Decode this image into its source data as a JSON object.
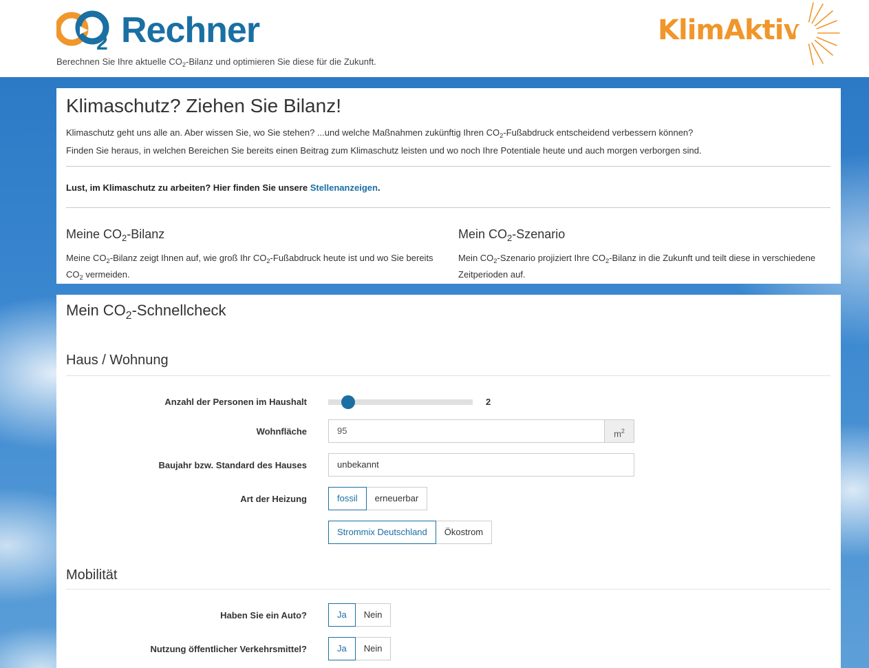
{
  "header": {
    "logo_text": "Rechner",
    "tagline_before": "Berechnen Sie Ihre aktuelle CO",
    "tagline_sub": "2",
    "tagline_after": "-Bilanz und optimieren Sie diese für die Zukunft.",
    "partner_logo_text": "KlimAktiv"
  },
  "colors": {
    "brand_blue": "#1a6fa3",
    "brand_orange": "#f0962a",
    "sky_blue": "#2c79c6"
  },
  "intro": {
    "title": "Klimaschutz? Ziehen Sie Bilanz!",
    "line1_before": "Klimaschutz geht uns alle an. Aber wissen Sie, wo Sie stehen? ...und welche Maßnahmen zukünftig Ihren CO",
    "line1_sub": "2",
    "line1_after": "-Fußabdruck entscheidend verbessern können?",
    "line2": "Finden Sie heraus, in welchen Bereichen Sie bereits einen Beitrag zum Klimaschutz leisten und wo noch Ihre Potentiale heute und auch morgen verborgen sind.",
    "jobs_text": "Lust, im Klimaschutz zu arbeiten? Hier finden Sie unsere ",
    "jobs_link": "Stellenanzeigen",
    "jobs_end": "."
  },
  "bilanz": {
    "title_before": "Meine CO",
    "title_after": "-Bilanz",
    "text_a": "Meine CO",
    "text_b": "-Bilanz zeigt Ihnen auf, wie groß Ihr CO",
    "text_c": "-Fußabdruck heute ist und wo Sie bereits CO",
    "text_d": " vermeiden."
  },
  "szenario": {
    "title_before": "Mein CO",
    "title_after": "-Szenario",
    "text_a": "Mein CO",
    "text_b": "-Szenario projiziert Ihre CO",
    "text_c": "-Bilanz in die Zukunft und teilt diese in verschiedene Zeitperioden auf."
  },
  "sub2": "2",
  "schnellcheck": {
    "title_before": "Mein CO",
    "title_after": "-Schnellcheck",
    "haus_title": "Haus / Wohnung",
    "persons_label": "Anzahl der Personen im Haushalt",
    "persons_value": "2",
    "persons_fraction": 0.1,
    "area_label": "Wohnfläche",
    "area_value": "95",
    "area_unit": "m",
    "area_unit_sup": "2",
    "year_label": "Baujahr bzw. Standard des Hauses",
    "year_value": "unbekannt",
    "heating_label": "Art der Heizung",
    "heating_options": [
      "fossil",
      "erneuerbar"
    ],
    "power_options": [
      "Strommix Deutschland",
      "Ökostrom"
    ],
    "mobil_title": "Mobilität",
    "car_label": "Haben Sie ein Auto?",
    "car_options": [
      "Ja",
      "Nein"
    ],
    "transit_label": "Nutzung öffentlicher Verkehrsmittel?",
    "transit_options": [
      "Ja",
      "Nein"
    ]
  }
}
